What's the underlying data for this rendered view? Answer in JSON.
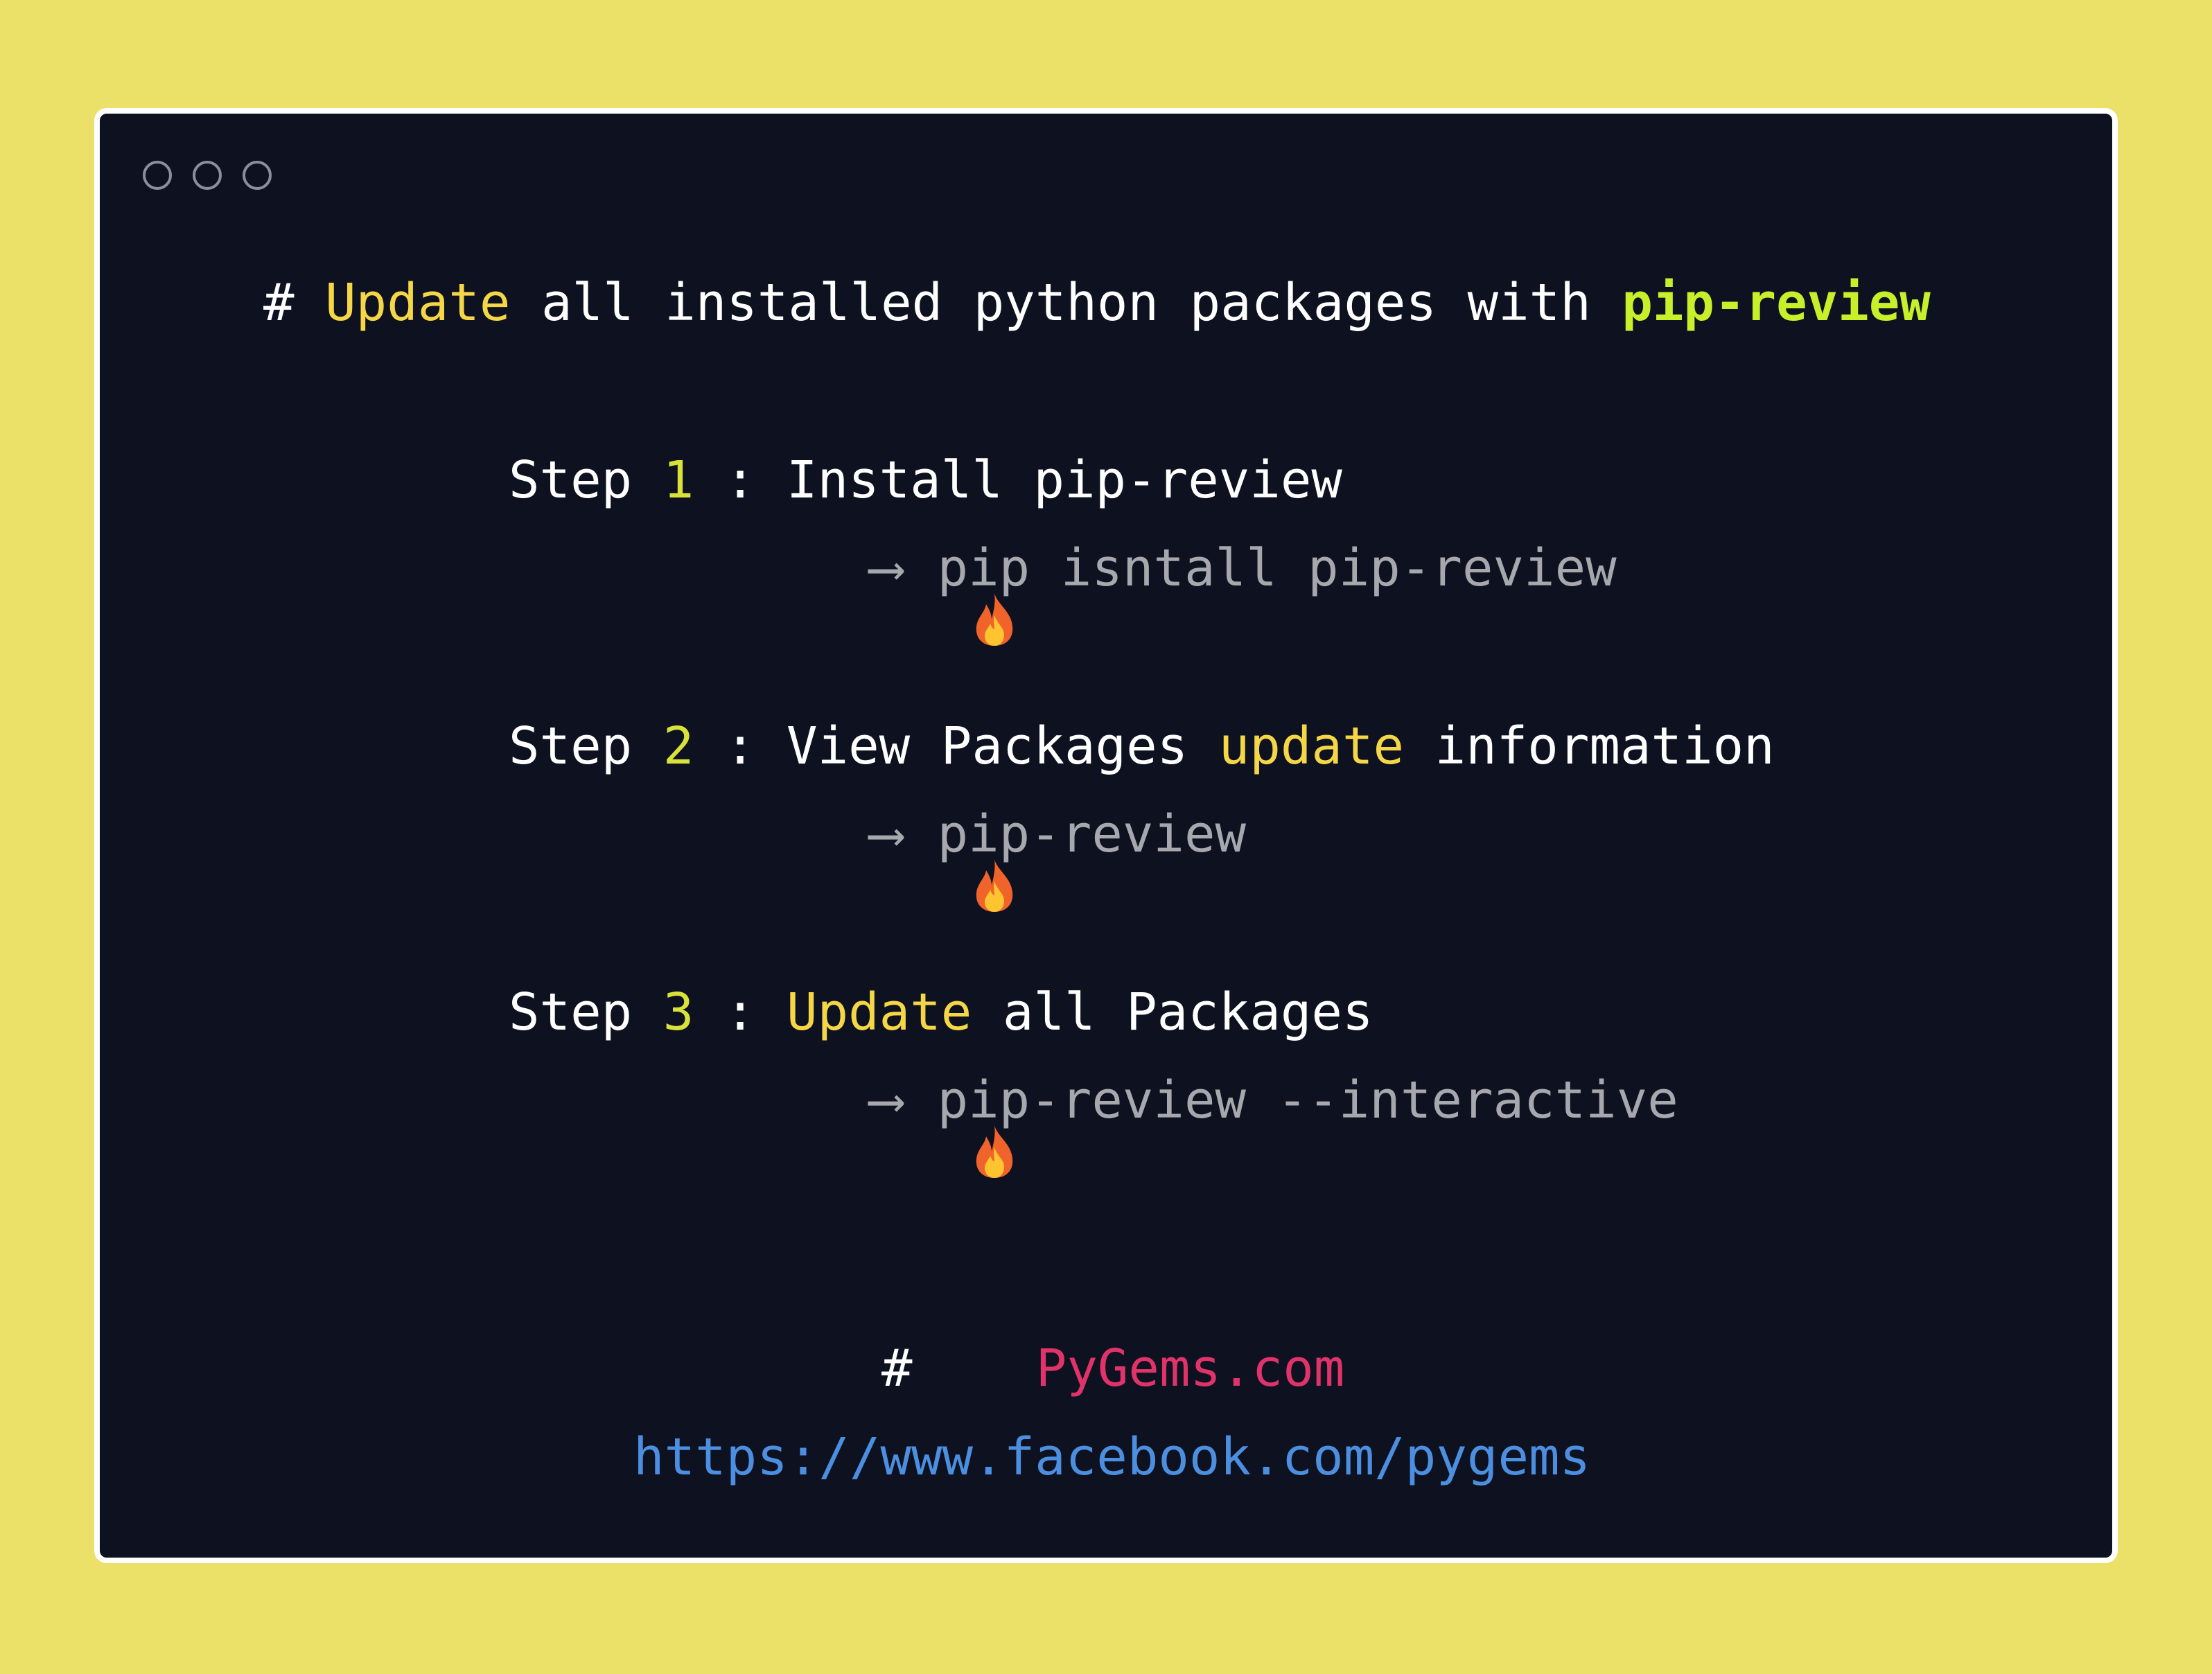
{
  "window": {
    "colors": {
      "background": "#ebe068",
      "panel": "#0d1120",
      "accent_yellow": "#f4d646",
      "accent_lime": "#c8f02a",
      "command_gray": "#a6a8ad",
      "brand_pink": "#e0336a",
      "link_blue": "#4c8fe0"
    }
  },
  "title": {
    "hash": "#",
    "word_update": "Update",
    "middle": "all installed python packages with",
    "tool": "pip-review"
  },
  "steps": [
    {
      "step_word": "Step",
      "number": "1",
      "colon": ":",
      "text_before": "Install pip-review",
      "highlight": "",
      "text_after": "",
      "icon": "fire-icon",
      "arrow": "⟶",
      "command": "pip isntall pip-review"
    },
    {
      "step_word": "Step",
      "number": "2",
      "colon": ":",
      "text_before": "View Packages",
      "highlight": "update",
      "text_after": "information",
      "icon": "fire-icon",
      "arrow": "⟶",
      "command": "pip-review"
    },
    {
      "step_word": "Step",
      "number": "3",
      "colon": ":",
      "text_before": "",
      "highlight": "Update",
      "text_after": "all Packages",
      "icon": "fire-icon",
      "arrow": "⟶",
      "command": "pip-review --interactive"
    }
  ],
  "footer": {
    "hash": "#",
    "brand": "PyGems.com",
    "url": "https://www.facebook.com/pygems"
  }
}
